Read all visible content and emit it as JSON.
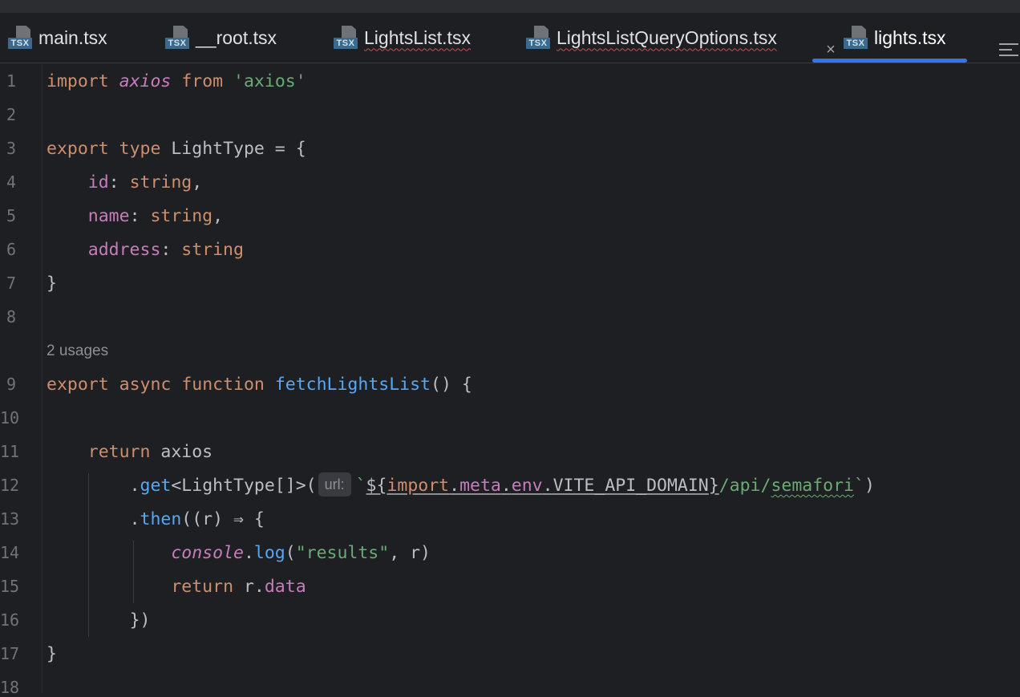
{
  "tabs": [
    {
      "label": "main.tsx",
      "icon": "tsx-file-icon",
      "badge": "TSX",
      "error": false,
      "active": false
    },
    {
      "label": "__root.tsx",
      "icon": "tsx-file-icon",
      "badge": "TSX",
      "error": false,
      "active": false
    },
    {
      "label": "LightsList.tsx",
      "icon": "tsx-file-icon",
      "badge": "TSX",
      "error": true,
      "active": false
    },
    {
      "label": "LightsListQueryOptions.tsx",
      "icon": "tsx-file-icon",
      "badge": "TSX",
      "error": true,
      "active": false
    },
    {
      "label": "lights.tsx",
      "icon": "tsx-file-icon",
      "badge": "TSX",
      "error": false,
      "active": true
    }
  ],
  "close_glyph": "×",
  "line_numbers": [
    "1",
    "2",
    "3",
    "4",
    "5",
    "6",
    "7",
    "8",
    "9",
    "10",
    "11",
    "12",
    "13",
    "14",
    "15",
    "16",
    "17",
    "18"
  ],
  "usages_hint": "2 usages",
  "code": {
    "l1": {
      "kw1": "import",
      "id": "axios",
      "kw2": "from",
      "str": "'axios'"
    },
    "l3": {
      "kw1": "export",
      "kw2": "type",
      "name": "LightType = {"
    },
    "l4": {
      "prop": "id",
      "rest": ": ",
      "type": "string",
      "end": ","
    },
    "l5": {
      "prop": "name",
      "rest": ": ",
      "type": "string",
      "end": ","
    },
    "l6": {
      "prop": "address",
      "rest": ": ",
      "type": "string"
    },
    "l7": {
      "text": "}"
    },
    "l9": {
      "kw1": "export",
      "kw2": "async",
      "kw3": "function",
      "fn": "fetchLightsList",
      "rest": "() {"
    },
    "l11": {
      "kw": "return",
      "rest": " axios"
    },
    "l12": {
      "dot": ".",
      "fn": "get",
      "generic": "<LightType[]>(",
      "hint": "url:",
      "tick": "`",
      "dollar": "${",
      "imp": "import",
      "d1": ".",
      "meta": "meta",
      "d2": ".",
      "env": "env",
      "d3": ".",
      "vite": "VITE_API_DOMAIN",
      "close": "}",
      "path1": "/api/",
      "path2": "semafori",
      "tick2": "`",
      "paren": ")"
    },
    "l13": {
      "dot": ".",
      "fn": "then",
      "rest": "((r) ⇒ {"
    },
    "l14": {
      "obj": "console",
      "dot": ".",
      "fn": "log",
      "open": "(",
      "str": "\"results\"",
      "rest": ", r)"
    },
    "l15": {
      "kw": "return",
      "rest": " r.",
      "prop": "data"
    },
    "l16": {
      "text": "})"
    },
    "l17": {
      "text": "}"
    }
  },
  "colors": {
    "keyword": "#cf8e6d",
    "string": "#6aab73",
    "property": "#c77dbb",
    "function": "#56a8f5",
    "text": "#bcbec4",
    "active_tab_indicator": "#3574f0"
  }
}
